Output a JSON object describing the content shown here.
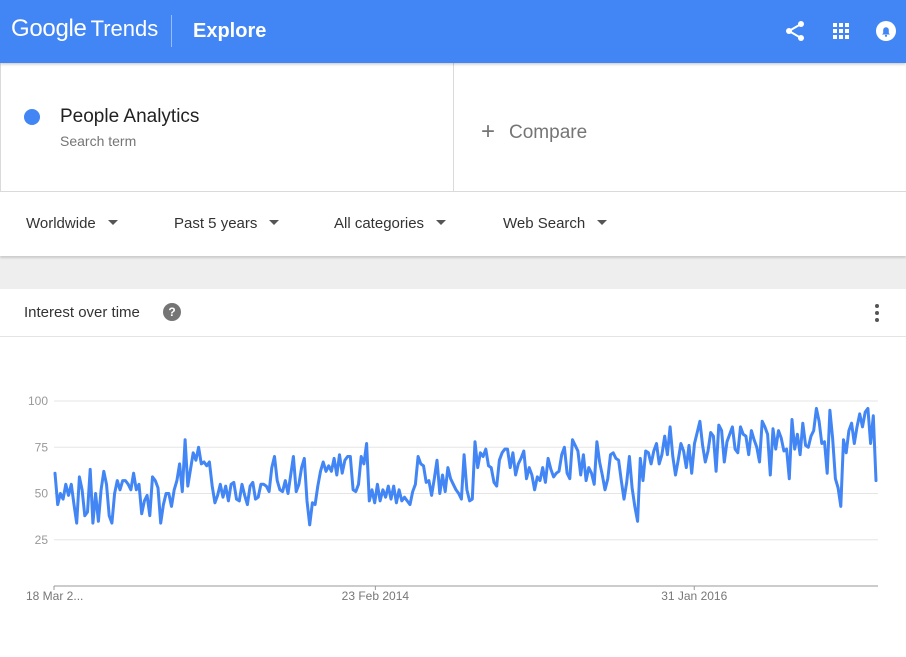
{
  "header": {
    "logo_google": "Google",
    "logo_trends": "Trends",
    "page_title": "Explore",
    "icons": [
      "share-icon",
      "apps-grid-icon",
      "notifications-icon"
    ]
  },
  "search": {
    "term": "People Analytics",
    "term_subtitle": "Search term",
    "compare_label": "Compare",
    "term_color": "#4285f4"
  },
  "filters": {
    "region": "Worldwide",
    "time": "Past 5 years",
    "category": "All categories",
    "property": "Web Search"
  },
  "card": {
    "title": "Interest over time",
    "help_glyph": "?"
  },
  "chart_data": {
    "type": "line",
    "title": "Interest over time",
    "ylim": [
      0,
      100
    ],
    "yticks": [
      25,
      50,
      75,
      100
    ],
    "xticks": [
      "18 Mar 2...",
      "23 Feb 2014",
      "31 Jan 2016"
    ],
    "series": [
      {
        "name": "People Analytics",
        "color": "#4285f4",
        "values": [
          61,
          44,
          50,
          47,
          55,
          49,
          55,
          44,
          34,
          59,
          52,
          38,
          40,
          63,
          34,
          50,
          35,
          52,
          62,
          55,
          38,
          34,
          50,
          57,
          52,
          57,
          57,
          55,
          52,
          61,
          52,
          55,
          39,
          46,
          49,
          38,
          59,
          57,
          53,
          34,
          44,
          50,
          50,
          43,
          52,
          57,
          66,
          51,
          79,
          54,
          63,
          72,
          68,
          75,
          66,
          67,
          65,
          67,
          54,
          45,
          49,
          55,
          48,
          54,
          46,
          55,
          56,
          47,
          46,
          55,
          49,
          44,
          54,
          56,
          47,
          48,
          55,
          55,
          54,
          51,
          64,
          70,
          57,
          52,
          51,
          57,
          50,
          60,
          70,
          51,
          55,
          64,
          69,
          46,
          33,
          45,
          44,
          54,
          62,
          67,
          62,
          65,
          62,
          69,
          60,
          71,
          61,
          68,
          70,
          70,
          52,
          51,
          55,
          70,
          66,
          77,
          46,
          52,
          45,
          55,
          46,
          52,
          48,
          54,
          47,
          54,
          45,
          52,
          46,
          48,
          46,
          44,
          51,
          55,
          70,
          66,
          65,
          56,
          57,
          49,
          58,
          68,
          50,
          60,
          51,
          64,
          58,
          55,
          52,
          50,
          47,
          71,
          52,
          46,
          47,
          78,
          64,
          72,
          70,
          74,
          65,
          64,
          56,
          54,
          68,
          72,
          74,
          74,
          64,
          72,
          60,
          66,
          69,
          73,
          58,
          64,
          60,
          52,
          59,
          57,
          64,
          56,
          69,
          63,
          59,
          61,
          62,
          71,
          75,
          61,
          58,
          79,
          76,
          73,
          60,
          71,
          57,
          64,
          61,
          55,
          78,
          67,
          60,
          52,
          58,
          71,
          72,
          69,
          68,
          57,
          47,
          56,
          70,
          53,
          43,
          35,
          69,
          57,
          73,
          72,
          66,
          73,
          77,
          66,
          71,
          81,
          71,
          86,
          70,
          60,
          68,
          77,
          73,
          64,
          76,
          61,
          77,
          83,
          89,
          76,
          67,
          73,
          83,
          81,
          62,
          87,
          84,
          67,
          78,
          82,
          86,
          74,
          72,
          86,
          82,
          81,
          71,
          84,
          79,
          75,
          67,
          89,
          86,
          82,
          60,
          85,
          74,
          84,
          80,
          73,
          74,
          58,
          90,
          74,
          82,
          71,
          88,
          76,
          75,
          81,
          84,
          96,
          89,
          77,
          78,
          61,
          95,
          80,
          58,
          53,
          43,
          79,
          72,
          84,
          88,
          77,
          86,
          93,
          86,
          94,
          96,
          77,
          92,
          57
        ],
        "display_values": [
          61,
          44,
          50,
          47,
          55,
          49,
          55,
          44,
          34,
          59,
          52,
          38,
          40,
          63,
          34,
          50,
          35,
          52,
          62,
          55,
          38,
          34,
          50,
          57,
          52,
          57,
          57,
          55,
          52,
          61,
          52,
          55,
          39,
          46,
          49,
          38,
          59,
          57,
          53,
          34,
          44,
          50,
          50,
          43,
          52,
          57,
          66,
          51,
          79,
          54,
          63,
          72,
          68,
          75,
          66,
          67,
          65,
          67,
          54,
          45,
          49,
          55,
          48,
          54,
          46,
          55,
          56,
          47,
          46,
          55,
          49,
          44,
          54,
          56,
          47,
          48,
          55,
          55,
          54,
          51,
          64,
          70,
          57,
          52,
          51,
          57,
          50,
          60,
          70,
          51,
          55,
          64,
          69,
          46,
          33,
          45,
          44,
          54,
          62,
          67,
          62,
          65,
          62,
          69,
          60,
          71,
          61,
          68,
          70,
          70,
          52,
          51,
          55,
          70,
          66,
          77,
          46,
          52,
          45,
          55,
          46,
          52,
          48,
          54,
          47,
          54,
          45,
          52,
          46,
          48,
          46,
          44,
          51,
          55,
          70,
          66,
          65,
          56,
          57,
          49,
          58,
          68,
          50,
          60,
          51,
          64,
          58,
          55,
          52,
          50,
          47,
          71,
          52,
          46,
          47,
          78,
          64,
          72,
          70,
          74,
          65,
          64,
          56,
          54,
          68,
          72,
          74,
          74,
          64,
          72,
          60,
          66,
          69,
          73,
          58,
          64,
          60,
          52,
          59,
          57,
          64,
          56,
          69,
          63,
          59,
          61,
          62,
          71,
          75,
          61,
          58,
          79,
          76,
          73,
          60,
          71,
          57,
          64,
          61,
          55,
          78,
          67,
          60,
          52,
          58,
          71,
          72,
          69,
          68,
          57,
          47,
          56,
          70,
          53,
          43,
          35,
          69,
          57,
          73,
          72,
          66,
          73,
          77,
          66,
          71,
          81,
          71,
          86,
          70,
          60,
          68,
          77,
          73,
          64,
          76,
          61,
          77,
          83,
          89,
          76,
          67,
          73,
          83,
          81,
          62,
          87,
          84,
          67,
          78,
          82,
          86,
          74,
          72,
          86,
          82,
          81,
          71,
          84,
          79,
          75,
          67,
          89,
          86,
          82,
          60,
          85,
          74,
          84,
          80,
          73,
          74,
          58,
          90,
          74,
          82,
          71,
          88,
          76,
          75,
          81,
          84,
          96,
          89,
          77,
          78,
          61,
          95,
          80,
          58,
          53,
          43,
          79,
          72,
          84,
          88,
          77,
          86,
          93,
          86,
          94,
          96,
          77,
          92,
          57
        ]
      }
    ]
  }
}
